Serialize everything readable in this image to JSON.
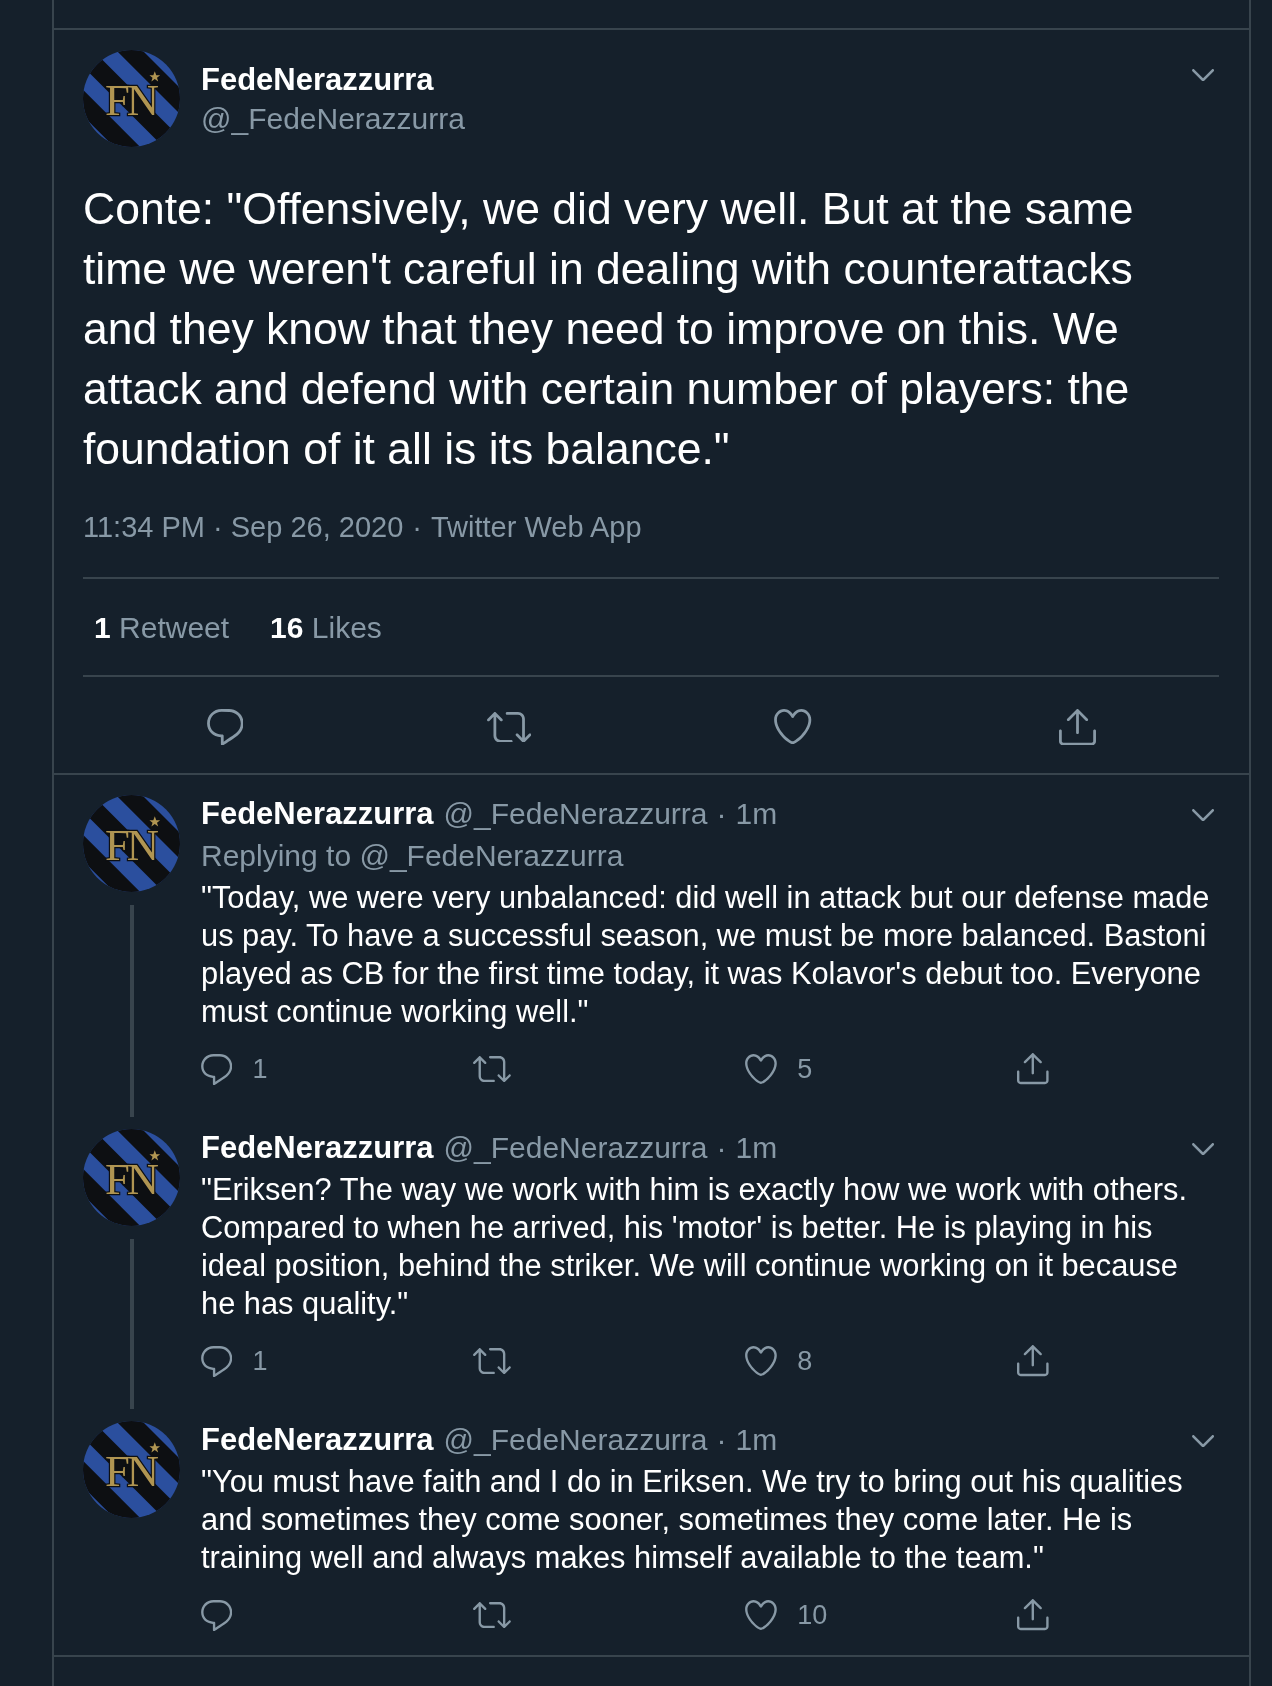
{
  "main_tweet": {
    "avatar": {
      "monogram": "FN"
    },
    "name": "FedeNerazzurra",
    "handle": "@_FedeNerazzurra",
    "text": "Conte: \"Offensively, we did very well. But at the same time we weren't careful in dealing with counterattacks and they know that they need to improve on this. We attack and defend with certain number of players: the foundation of it all is its balance.\"",
    "timestamp": "11:34 PM · Sep 26, 2020",
    "separator": "·",
    "source": "Twitter Web App",
    "stats": [
      {
        "count": "1",
        "label": "Retweet"
      },
      {
        "count": "16",
        "label": "Likes"
      }
    ],
    "actions": [
      {
        "kind": "reply"
      },
      {
        "kind": "retweet"
      },
      {
        "kind": "like"
      },
      {
        "kind": "share"
      }
    ]
  },
  "replies": [
    {
      "avatar": {
        "monogram": "FN"
      },
      "name": "FedeNerazzurra",
      "handle": "@_FedeNerazzurra",
      "separator": "·",
      "time": "1m",
      "replying_to": {
        "label": "Replying to",
        "handle": "@_FedeNerazzurra"
      },
      "text": "\"Today, we were very unbalanced: did well in attack but our defense made us pay. To have a successful season, we must be more balanced. Bastoni played as CB for the first time today, it was Kolavor's debut too. Everyone must continue working well.\"",
      "actions": [
        {
          "kind": "reply",
          "count": "1"
        },
        {
          "kind": "retweet"
        },
        {
          "kind": "like",
          "count": "5"
        },
        {
          "kind": "share"
        }
      ],
      "thread_continues": true
    },
    {
      "avatar": {
        "monogram": "FN"
      },
      "name": "FedeNerazzurra",
      "handle": "@_FedeNerazzurra",
      "separator": "·",
      "time": "1m",
      "text": "\"Eriksen? The way we work with him is exactly how we work with others. Compared to when he arrived, his 'motor' is better. He is playing in his ideal position, behind the striker. We will continue working on it because he has quality.\"",
      "actions": [
        {
          "kind": "reply",
          "count": "1"
        },
        {
          "kind": "retweet"
        },
        {
          "kind": "like",
          "count": "8"
        },
        {
          "kind": "share"
        }
      ],
      "thread_continues": true
    },
    {
      "avatar": {
        "monogram": "FN"
      },
      "name": "FedeNerazzurra",
      "handle": "@_FedeNerazzurra",
      "separator": "·",
      "time": "1m",
      "text": "\"You must have faith and I do in Eriksen. We try to bring out his qualities and sometimes they come sooner, sometimes they come later. He is training well and always makes himself available to the team.\"",
      "actions": [
        {
          "kind": "reply"
        },
        {
          "kind": "retweet"
        },
        {
          "kind": "like",
          "count": "10"
        },
        {
          "kind": "share"
        }
      ],
      "thread_continues": false
    }
  ]
}
